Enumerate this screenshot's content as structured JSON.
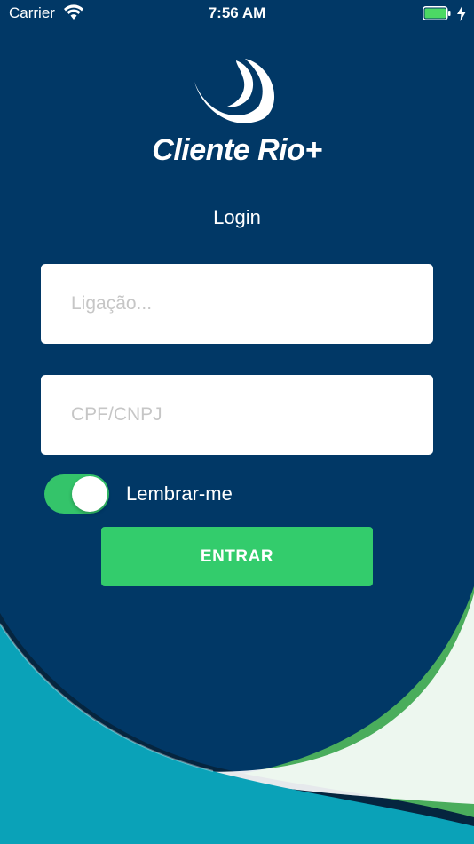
{
  "status_bar": {
    "carrier": "Carrier",
    "time": "7:56 AM",
    "icons": [
      "wifi-icon",
      "battery-icon",
      "charging-icon"
    ]
  },
  "brand": {
    "name": "Cliente Rio+",
    "logo_icon": "swirl-logo-icon"
  },
  "login": {
    "title": "Login",
    "ligacao_placeholder": "Ligação...",
    "ligacao_value": "",
    "document_placeholder": "CPF/CNPJ",
    "document_value": "",
    "remember_label": "Lembrar-me",
    "remember_on": true,
    "submit_label": "ENTRAR"
  },
  "colors": {
    "background_navy": "#013866",
    "teal_wave": "#0aa2b8",
    "green_wave": "#4aad5c",
    "accent_green": "#33cc6c",
    "text_white": "#ffffff",
    "placeholder_gray": "#c6c6c6"
  }
}
